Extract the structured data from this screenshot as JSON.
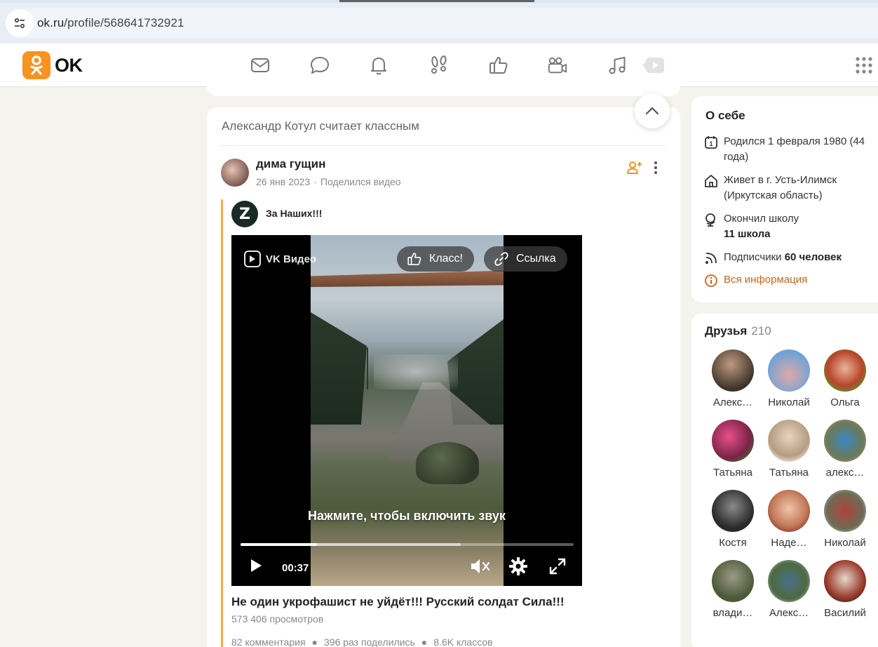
{
  "browser": {
    "url_host": "ok.ru",
    "url_path": "/profile/568641732921"
  },
  "header": {
    "logo_text": "OK",
    "nav_icons": [
      "mail-icon",
      "chat-icon",
      "bell-icon",
      "footprints-icon",
      "like-icon",
      "video-camera-icon",
      "music-icon",
      "play-icon"
    ],
    "apps_icon": "grid-icon"
  },
  "feed": {
    "card_header": "Александр Котул считает классным",
    "post": {
      "author": "дима гущин",
      "date": "26 янв 2023",
      "action": "Поделился видео",
      "group_name": "За Наших!!!",
      "group_avatar_letter": "Z",
      "video": {
        "brand": "VK Видео",
        "like_button": "Класс!",
        "link_button": "Ссылка",
        "unmute_hint": "Нажмите, чтобы включить звук",
        "time": "00:37",
        "progress": 0.23,
        "buffered": 0.66
      },
      "title": "Не один укрофашист не уйдёт!!! Русский солдат Сила!!!",
      "views": "573 406 просмотров",
      "stats": [
        "82 комментария",
        "396 раз поделились",
        "8.6K классов"
      ]
    }
  },
  "about": {
    "title": "О себе",
    "born_prefix": "Родился",
    "born_value": "1 февраля 1980 (44 года)",
    "lives": "Живет в г. Усть-Илимск (Иркутская область)",
    "school_label": "Окончил школу",
    "school_value": "11 школа",
    "subscribers_label": "Подписчики",
    "subscribers_value": "60 человек",
    "more_link": "Вся информация"
  },
  "friends": {
    "title": "Друзья",
    "count": "210",
    "items": [
      {
        "name": "Алекс…"
      },
      {
        "name": "Николай"
      },
      {
        "name": "Ольга"
      },
      {
        "name": "Татьяна"
      },
      {
        "name": "Татьяна"
      },
      {
        "name": "алекс…"
      },
      {
        "name": "Костя"
      },
      {
        "name": "Наде…"
      },
      {
        "name": "Николай"
      },
      {
        "name": "влади…"
      },
      {
        "name": "Алекс…"
      },
      {
        "name": "Василий"
      }
    ]
  },
  "colors": {
    "accent": "#f7931e",
    "link": "#c8641a"
  }
}
